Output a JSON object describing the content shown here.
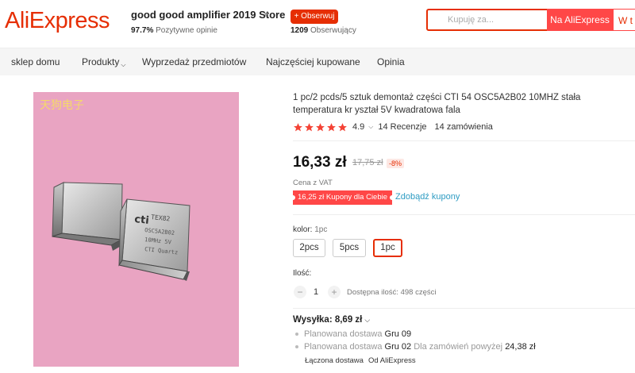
{
  "header": {
    "logo": "AliExpress",
    "store_name": "good good amplifier 2019 Store",
    "store_rating_value": "97.7%",
    "store_rating_label": "Pozytywne opinie",
    "follow_label": "+ Obserwuj",
    "followers_count": "1209",
    "followers_label": "Obserwujący",
    "search_placeholder": "Kupuję za...",
    "search_button": "Na AliExpress",
    "search_button2": "W t"
  },
  "nav": {
    "items": [
      "sklep domu",
      "Produkty",
      "Wyprzedaż przedmiotów",
      "Najczęściej kupowane",
      "Opinia"
    ]
  },
  "image": {
    "watermark": "天狗电子"
  },
  "product": {
    "title": "1 pc/2 pcds/5 sztuk demontaż części CTI 54 OSC5A2B02 10MHZ stała temperatura kr yształ 5V kwadratowa fala",
    "rating_score": "4.9",
    "stars": 5,
    "reviews": "14 Recenzje",
    "orders": "14 zamówienia",
    "price": "16,33 zł",
    "old_price": "17,75 zł",
    "discount": "-8%",
    "vat": "Cena z VAT",
    "coupon": "16,25 zł Kupony dla Ciebie",
    "coupon_link": "Zdobądź kupony",
    "color_label": "kolor:",
    "color_value": "1pc",
    "options": [
      "2pcs",
      "5pcs",
      "1pc"
    ],
    "selected_option": "1pc",
    "qty_label": "Ilość:",
    "qty_minus": "−",
    "qty_value": "1",
    "qty_plus": "+",
    "stock": "Dostępna ilość: 498 części"
  },
  "shipping": {
    "title": "Wysyłka: 8,69 zł",
    "line1_prefix": "Planowana dostawa",
    "line1_value": "Gru 09",
    "line2_prefix": "Planowana dostawa",
    "line2_value": "Gru 02",
    "line2_suffix": "Dla zamówień powyżej",
    "line2_amount": "24,38 zł",
    "combined": "Łączona dostawa",
    "from": "Od AliExpress"
  },
  "colors": {
    "accent": "#e62e04",
    "search_button": "#ff4747",
    "link": "#2e9cc3",
    "star": "#f44336",
    "image_bg": "#e9a4c2"
  }
}
